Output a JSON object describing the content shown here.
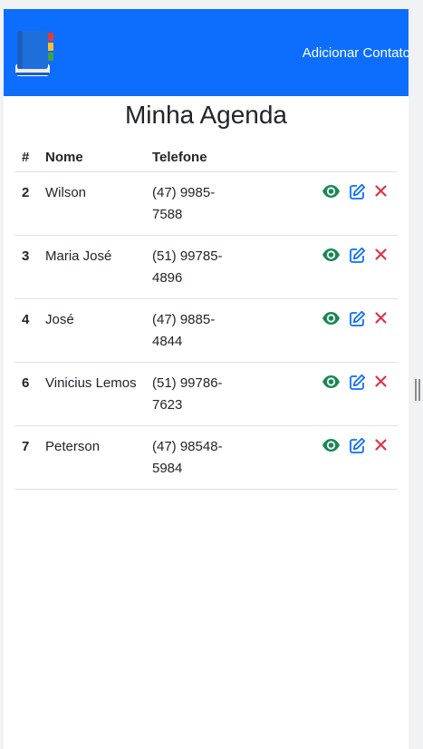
{
  "navbar": {
    "link_label": "Adicionar Contato",
    "logo_icon": "address-book-icon",
    "background": "#0d6efd"
  },
  "page_title": "Minha Agenda",
  "table": {
    "headers": [
      "#",
      "Nome",
      "Telefone"
    ],
    "rows": [
      {
        "id": "2",
        "name": "Wilson",
        "phone": "(47) 9985-7588"
      },
      {
        "id": "3",
        "name": "Maria José",
        "phone": "(51) 99785-4896"
      },
      {
        "id": "4",
        "name": "José",
        "phone": "(47) 9885-4844"
      },
      {
        "id": "6",
        "name": "Vinicius Lemos",
        "phone": "(51) 99786-7623"
      },
      {
        "id": "7",
        "name": "Peterson",
        "phone": "(47) 98548-5984"
      }
    ],
    "actions": [
      {
        "icon": "eye-icon",
        "color": "#198754"
      },
      {
        "icon": "edit-icon",
        "color": "#0d6efd"
      },
      {
        "icon": "close-icon",
        "color": "#dc3545"
      }
    ]
  }
}
